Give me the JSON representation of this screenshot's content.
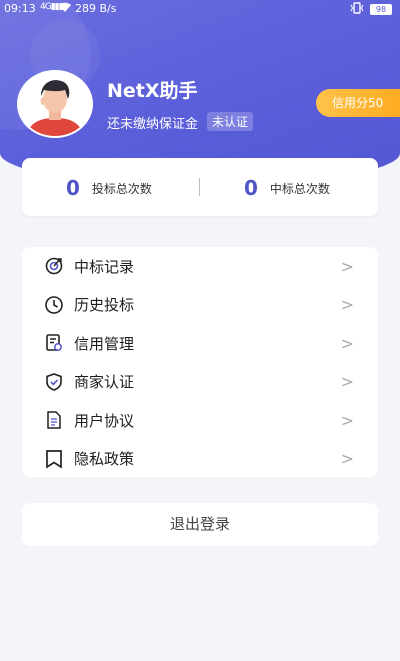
{
  "status_bar": {
    "time": "09:13",
    "signal": "4G▮▮▮",
    "wifi_icon": "wifi-icon",
    "network_speed": "289 B/s",
    "vibrate_icon": "vibrate-icon",
    "battery": "98"
  },
  "profile": {
    "username": "NetX助手",
    "deposit_status": "还未缴纳保证金",
    "verify_status": "未认证",
    "credit_label": "信用分50"
  },
  "stats": {
    "bids_count": "0",
    "bids_label": "投标总次数",
    "wins_count": "0",
    "wins_label": "中标总次数"
  },
  "menu": {
    "items": [
      {
        "label": "中标记录",
        "icon": "target-icon"
      },
      {
        "label": "历史投标",
        "icon": "clock-icon"
      },
      {
        "label": "信用管理",
        "icon": "certificate-icon"
      },
      {
        "label": "商家认证",
        "icon": "shield-check-icon"
      },
      {
        "label": "用户协议",
        "icon": "document-icon"
      },
      {
        "label": "隐私政策",
        "icon": "bookmark-icon"
      }
    ],
    "chevron": ">"
  },
  "logout_label": "退出登录",
  "colors": {
    "accent": "#5a5ed9",
    "credit_badge": "#ffb12e",
    "stat_number": "#4f55c7",
    "background": "#f4f5f9"
  }
}
